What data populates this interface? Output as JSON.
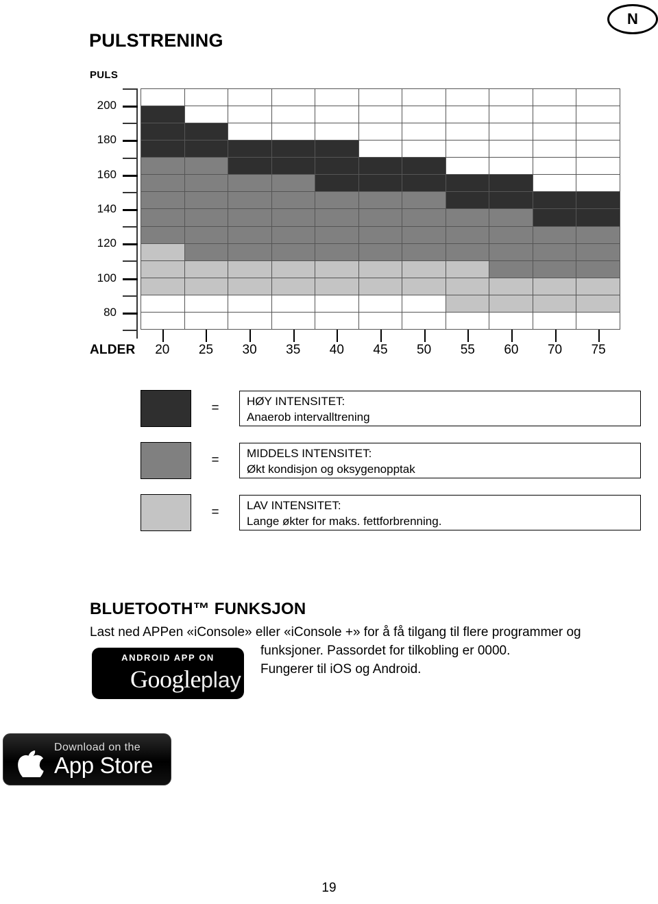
{
  "badge": {
    "country_code": "N"
  },
  "page_title": "PULSTRENING",
  "page_number": "19",
  "chart_data": {
    "type": "heatmap",
    "title": "PULSTRENING",
    "xlabel": "ALDER",
    "ylabel": "PULS",
    "categories": [
      "20",
      "25",
      "30",
      "35",
      "40",
      "45",
      "50",
      "55",
      "60",
      "70",
      "75"
    ],
    "ytick_labels": [
      "200",
      "180",
      "160",
      "140",
      "120",
      "100",
      "80"
    ],
    "ylim": [
      70,
      210
    ],
    "grid": true,
    "legend_position": "below",
    "zone_colors": {
      "high": "#2f2f2f",
      "mid": "#808080",
      "low": "#c4c4c4",
      "empty": "#ffffff"
    },
    "row_upper_bpm": [
      210,
      200,
      190,
      180,
      170,
      160,
      150,
      140,
      130,
      120,
      110,
      100,
      90,
      80
    ],
    "matrix": [
      [
        "empty",
        "empty",
        "empty",
        "empty",
        "empty",
        "empty",
        "empty",
        "empty",
        "empty",
        "empty",
        "empty"
      ],
      [
        "high",
        "empty",
        "empty",
        "empty",
        "empty",
        "empty",
        "empty",
        "empty",
        "empty",
        "empty",
        "empty"
      ],
      [
        "high",
        "high",
        "empty",
        "empty",
        "empty",
        "empty",
        "empty",
        "empty",
        "empty",
        "empty",
        "empty"
      ],
      [
        "high",
        "high",
        "high",
        "high",
        "high",
        "empty",
        "empty",
        "empty",
        "empty",
        "empty",
        "empty"
      ],
      [
        "mid",
        "mid",
        "high",
        "high",
        "high",
        "high",
        "high",
        "empty",
        "empty",
        "empty",
        "empty"
      ],
      [
        "mid",
        "mid",
        "mid",
        "mid",
        "high",
        "high",
        "high",
        "high",
        "high",
        "empty",
        "empty"
      ],
      [
        "mid",
        "mid",
        "mid",
        "mid",
        "mid",
        "mid",
        "mid",
        "high",
        "high",
        "high",
        "high"
      ],
      [
        "mid",
        "mid",
        "mid",
        "mid",
        "mid",
        "mid",
        "mid",
        "mid",
        "mid",
        "high",
        "high"
      ],
      [
        "mid",
        "mid",
        "mid",
        "mid",
        "mid",
        "mid",
        "mid",
        "mid",
        "mid",
        "mid",
        "mid"
      ],
      [
        "low",
        "mid",
        "mid",
        "mid",
        "mid",
        "mid",
        "mid",
        "mid",
        "mid",
        "mid",
        "mid"
      ],
      [
        "low",
        "low",
        "low",
        "low",
        "low",
        "low",
        "low",
        "low",
        "mid",
        "mid",
        "mid"
      ],
      [
        "low",
        "low",
        "low",
        "low",
        "low",
        "low",
        "low",
        "low",
        "low",
        "low",
        "low"
      ],
      [
        "empty",
        "empty",
        "empty",
        "empty",
        "empty",
        "empty",
        "empty",
        "low",
        "low",
        "low",
        "low"
      ],
      [
        "empty",
        "empty",
        "empty",
        "empty",
        "empty",
        "empty",
        "empty",
        "empty",
        "empty",
        "empty",
        "empty"
      ]
    ]
  },
  "legend": [
    {
      "zone": "high",
      "equals": "=",
      "line1": "HØY INTENSITET:",
      "line2": "Anaerob intervalltrening"
    },
    {
      "zone": "mid",
      "equals": "=",
      "line1": "MIDDELS INTENSITET:",
      "line2": "Økt kondisjon og oksygenopptak"
    },
    {
      "zone": "low",
      "equals": "=",
      "line1": "LAV INTENSITET:",
      "line2": "Lange økter for maks. fettforbrenning."
    }
  ],
  "bluetooth": {
    "title": "BLUETOOTH™ FUNKSJON",
    "line1": "Last ned APPen «iConsole» eller «iConsole +» for å få tilgang til flere programmer og",
    "line2": "funksjoner. Passordet for tilkobling er 0000.",
    "line3": "Fungerer til iOS og Android."
  },
  "badges": {
    "google_play": {
      "top_text": "ANDROID APP ON",
      "brand": "Google",
      "suffix": "play"
    },
    "app_store": {
      "top_text": "Download on the",
      "brand": "App Store",
      "apple_glyph": ""
    }
  }
}
